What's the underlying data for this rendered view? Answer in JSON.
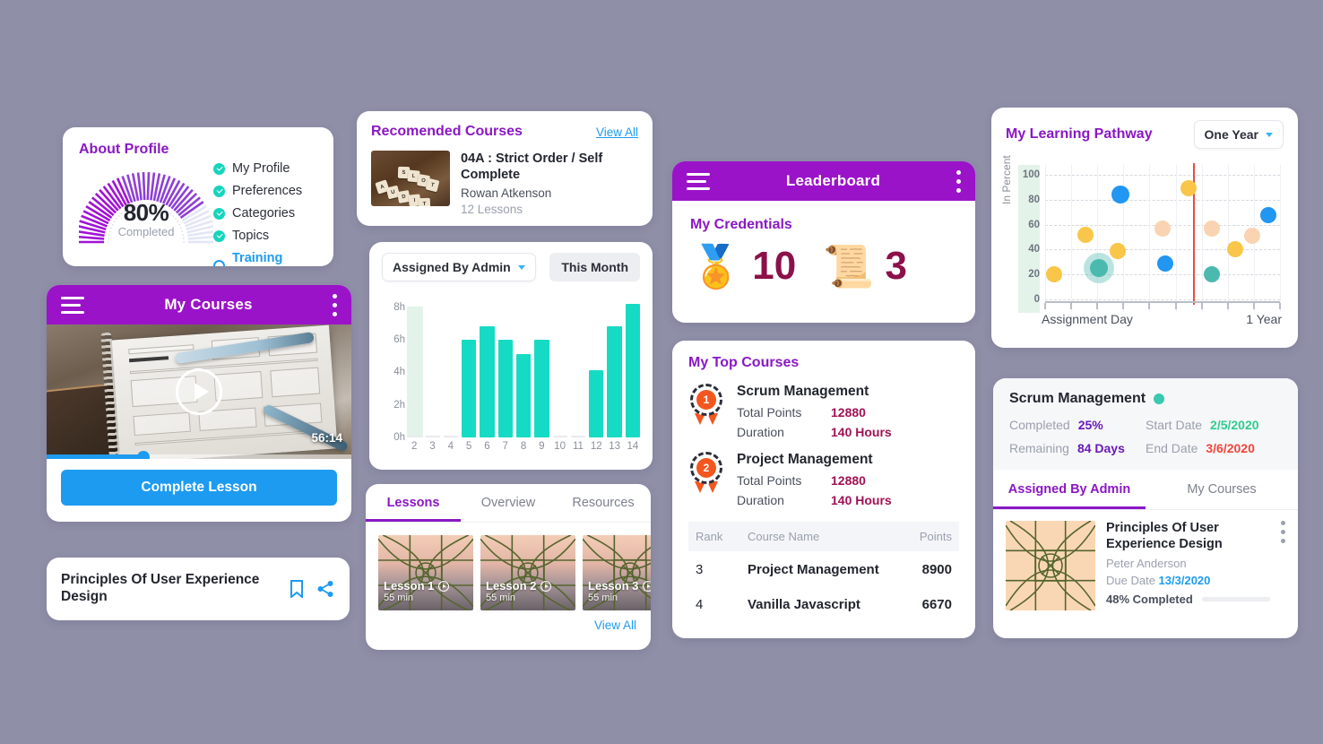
{
  "about_profile": {
    "title": "About Profile",
    "gauge": {
      "percent": 80,
      "percent_label": "80%",
      "caption": "Completed"
    },
    "items": [
      {
        "label": "My Profile",
        "state": "checked"
      },
      {
        "label": "Preferences",
        "state": "checked"
      },
      {
        "label": "Categories",
        "state": "checked"
      },
      {
        "label": "Topics",
        "state": "checked"
      },
      {
        "label": "Training Targets",
        "state": "empty"
      }
    ]
  },
  "recommended": {
    "title": "Recomended Courses",
    "view_all": "View All",
    "course": {
      "title": "04A : Strict Order / Self Complete",
      "author": "Rowan Atkenson",
      "lessons": "12 Lessons",
      "thumb_letters": [
        "A",
        "U",
        "D",
        "I",
        "T",
        "S",
        "L",
        "O",
        "T"
      ]
    }
  },
  "barchart_card": {
    "filter_label": "Assigned By Admin",
    "range_label": "This Month"
  },
  "my_courses": {
    "title": "My Courses",
    "timestamp": "56:14",
    "progress_percent": 32,
    "complete_button": "Complete Lesson"
  },
  "lessons_card": {
    "tabs": [
      {
        "label": "Lessons",
        "active": true
      },
      {
        "label": "Overview",
        "active": false
      },
      {
        "label": "Resources",
        "active": false
      }
    ],
    "lessons": [
      {
        "name": "Lesson 1",
        "duration": "55 min"
      },
      {
        "name": "Lesson 2",
        "duration": "55 min"
      },
      {
        "name": "Lesson 3",
        "duration": "55 min"
      }
    ],
    "view_all": "View All"
  },
  "pux_card": {
    "title": "Principles Of User Experience Design",
    "bookmark_icon": "bookmark-icon",
    "share_icon": "share-icon"
  },
  "leaderboard": {
    "title": "Leaderboard",
    "section_title": "My Credentials",
    "credentials": [
      {
        "icon": "medal-icon",
        "glyph": "🏅",
        "count": "10"
      },
      {
        "icon": "certificate-icon",
        "glyph": "📜",
        "count": "3"
      }
    ]
  },
  "top_courses": {
    "title": "My Top Courses",
    "highlights": [
      {
        "rank": "1",
        "name": "Scrum Management",
        "rows": [
          {
            "key": "Total Points",
            "value": "12880"
          },
          {
            "key": "Duration",
            "value": "140 Hours"
          }
        ]
      },
      {
        "rank": "2",
        "name": "Project Management",
        "rows": [
          {
            "key": "Total Points",
            "value": "12880"
          },
          {
            "key": "Duration",
            "value": "140 Hours"
          }
        ]
      }
    ],
    "table": {
      "headers": {
        "rank": "Rank",
        "name": "Course Name",
        "points": "Points"
      },
      "rows": [
        {
          "rank": "3",
          "name": "Project Management",
          "points": "8900"
        },
        {
          "rank": "4",
          "name": "Vanilla Javascript",
          "points": "6670"
        }
      ]
    }
  },
  "pathway": {
    "title": "My Learning Pathway",
    "range_label": "One Year"
  },
  "scrum_card": {
    "title": "Scrum Management",
    "status_color": "#38c9b0",
    "fields": [
      {
        "key": "Completed",
        "value": "25%",
        "tone": "purple"
      },
      {
        "key": "Start Date",
        "value": "2/5/2020",
        "tone": "green"
      },
      {
        "key": "Remaining",
        "value": "84 Days",
        "tone": "purple"
      },
      {
        "key": "End Date",
        "value": "3/6/2020",
        "tone": "red"
      }
    ],
    "tabs": [
      {
        "label": "Assigned By Admin",
        "active": true
      },
      {
        "label": "My Courses",
        "active": false
      }
    ],
    "item": {
      "title": "Principles Of User Experience Design",
      "author": "Peter Anderson",
      "due_label": "Due Date",
      "due_value": "13/3/2020",
      "progress_label": "48% Completed",
      "progress_percent": 48
    }
  },
  "chart_data": [
    {
      "type": "bar",
      "title": "Assigned By Admin",
      "xlabel": "",
      "ylabel": "",
      "categories": [
        "2",
        "3",
        "4",
        "5",
        "6",
        "7",
        "8",
        "9",
        "10",
        "11",
        "12",
        "13",
        "14"
      ],
      "values": [
        0,
        0,
        0,
        6.0,
        6.8,
        6.0,
        5.1,
        6.0,
        0,
        0,
        4.1,
        6.8,
        8.2
      ],
      "ytick_labels": [
        "0h",
        "2h",
        "4h",
        "6h",
        "8h"
      ],
      "ytick_values": [
        0,
        2,
        4,
        6,
        8
      ],
      "ylim": [
        0,
        8.8
      ],
      "bar_color": "#16dbc4",
      "highlight_band_category": "2",
      "grid": false,
      "legend": "none"
    },
    {
      "type": "scatter",
      "title": "My Learning Pathway",
      "xlabel": "Assignment Day",
      "xlabel_right": "1 Year",
      "ylabel": "In Percent",
      "ylim": [
        0,
        108
      ],
      "xlim": [
        0,
        100
      ],
      "ytick_values": [
        0,
        20,
        40,
        60,
        80,
        100
      ],
      "ytick_labels": [
        "0",
        "20",
        "40",
        "60",
        "80",
        "100"
      ],
      "grid": true,
      "legend": "none",
      "marker_line": {
        "x": 63,
        "color": "#ef4a3f"
      },
      "points": [
        {
          "x": 4,
          "y": 20,
          "color": "#f9c64a",
          "r": 9,
          "halo": false
        },
        {
          "x": 17,
          "y": 52,
          "color": "#f9c64a",
          "r": 9,
          "halo": false
        },
        {
          "x": 23,
          "y": 25,
          "color": "#4cb9ae",
          "r": 10,
          "halo": true
        },
        {
          "x": 31,
          "y": 39,
          "color": "#f9c64a",
          "r": 9,
          "halo": false
        },
        {
          "x": 32,
          "y": 84,
          "color": "#2196f3",
          "r": 10,
          "halo": false
        },
        {
          "x": 50,
          "y": 57,
          "color": "#fad4b2",
          "r": 9,
          "halo": false
        },
        {
          "x": 51,
          "y": 29,
          "color": "#2196f3",
          "r": 9,
          "halo": false
        },
        {
          "x": 61,
          "y": 89,
          "color": "#f9c64a",
          "r": 9,
          "halo": false
        },
        {
          "x": 71,
          "y": 57,
          "color": "#fad4b2",
          "r": 9,
          "halo": false
        },
        {
          "x": 71,
          "y": 20,
          "color": "#4cb9ae",
          "r": 9,
          "halo": false
        },
        {
          "x": 81,
          "y": 40,
          "color": "#f9c64a",
          "r": 9,
          "halo": false
        },
        {
          "x": 88,
          "y": 51,
          "color": "#fad4b2",
          "r": 9,
          "halo": false
        },
        {
          "x": 95,
          "y": 68,
          "color": "#2196f3",
          "r": 9,
          "halo": false
        }
      ]
    }
  ]
}
